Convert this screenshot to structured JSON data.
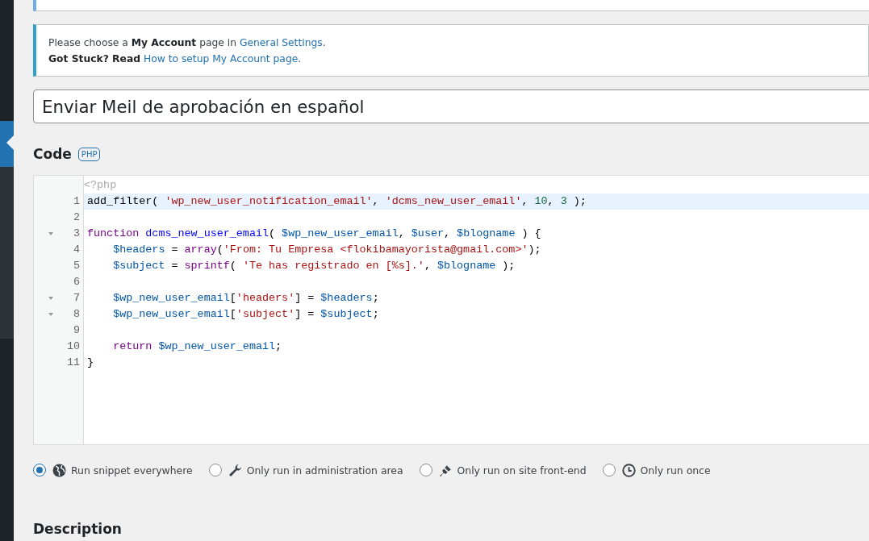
{
  "notice": {
    "lines": [
      {
        "before": "Please choose a **My Account** page in ",
        "link": "General Settings",
        "after": "."
      },
      {
        "before": "**Got Stuck? Read** ",
        "link": "How to setup My Account page",
        "after": "."
      }
    ]
  },
  "snippet_title": {
    "value": "Enviar Meil de aprobación en español"
  },
  "code_section": {
    "heading": "Code",
    "badge": "PHP"
  },
  "editor": {
    "opening_tag": "<?php",
    "lines": [
      {
        "number": "1",
        "foldable": false,
        "active": true,
        "tokens": [
          {
            "kind": "plain",
            "text": "add_filter( "
          },
          {
            "kind": "string",
            "text": "'wp_new_user_notification_email'"
          },
          {
            "kind": "plain",
            "text": ", "
          },
          {
            "kind": "string",
            "text": "'dcms_new_user_email'"
          },
          {
            "kind": "plain",
            "text": ", "
          },
          {
            "kind": "number",
            "text": "10"
          },
          {
            "kind": "plain",
            "text": ", "
          },
          {
            "kind": "number",
            "text": "3"
          },
          {
            "kind": "plain",
            "text": " );"
          }
        ]
      },
      {
        "number": "2",
        "foldable": false,
        "active": false
      },
      {
        "number": "3",
        "foldable": true,
        "active": false,
        "tokens": [
          {
            "kind": "keyword",
            "text": "function "
          },
          {
            "kind": "def",
            "text": "dcms_new_user_email"
          },
          {
            "kind": "plain",
            "text": "( "
          },
          {
            "kind": "variable",
            "text": "$wp_new_user_email"
          },
          {
            "kind": "plain",
            "text": ", "
          },
          {
            "kind": "variable",
            "text": "$user"
          },
          {
            "kind": "plain",
            "text": ", "
          },
          {
            "kind": "variable",
            "text": "$blogname"
          },
          {
            "kind": "plain",
            "text": " ) {"
          }
        ]
      },
      {
        "number": "4",
        "foldable": false,
        "active": false,
        "tokens": [
          {
            "kind": "variable",
            "text": "    $headers"
          },
          {
            "kind": "plain",
            "text": " = "
          },
          {
            "kind": "keyword",
            "text": "array"
          },
          {
            "kind": "plain",
            "text": "("
          },
          {
            "kind": "string",
            "text": "'From: Tu Empresa <flokibamayorista@gmail.com>'"
          },
          {
            "kind": "plain",
            "text": ");"
          }
        ]
      },
      {
        "number": "5",
        "foldable": false,
        "active": false,
        "tokens": [
          {
            "kind": "variable",
            "text": "    $subject"
          },
          {
            "kind": "plain",
            "text": " = "
          },
          {
            "kind": "keyword",
            "text": "sprintf"
          },
          {
            "kind": "plain",
            "text": "( "
          },
          {
            "kind": "string",
            "text": "'Te has registrado en [%s].'"
          },
          {
            "kind": "plain",
            "text": ", "
          },
          {
            "kind": "variable",
            "text": "$blogname"
          },
          {
            "kind": "plain",
            "text": " );"
          }
        ]
      },
      {
        "number": "6",
        "foldable": false,
        "active": false
      },
      {
        "number": "7",
        "foldable": true,
        "active": false,
        "tokens": [
          {
            "kind": "variable",
            "text": "    $wp_new_user_email"
          },
          {
            "kind": "plain",
            "text": "["
          },
          {
            "kind": "string",
            "text": "'headers'"
          },
          {
            "kind": "plain",
            "text": "] = "
          },
          {
            "kind": "variable",
            "text": "$headers"
          },
          {
            "kind": "plain",
            "text": ";"
          }
        ]
      },
      {
        "number": "8",
        "foldable": true,
        "active": false,
        "tokens": [
          {
            "kind": "variable",
            "text": "    $wp_new_user_email"
          },
          {
            "kind": "plain",
            "text": "["
          },
          {
            "kind": "string",
            "text": "'subject'"
          },
          {
            "kind": "plain",
            "text": "] = "
          },
          {
            "kind": "variable",
            "text": "$subject"
          },
          {
            "kind": "plain",
            "text": ";"
          }
        ]
      },
      {
        "number": "9",
        "foldable": false,
        "active": false
      },
      {
        "number": "10",
        "foldable": false,
        "active": false,
        "tokens": [
          {
            "kind": "keyword",
            "text": "    return "
          },
          {
            "kind": "variable",
            "text": "$wp_new_user_email"
          },
          {
            "kind": "plain",
            "text": ";"
          }
        ]
      },
      {
        "number": "11",
        "foldable": false,
        "active": false,
        "tokens": [
          {
            "kind": "plain",
            "text": "}"
          }
        ]
      }
    ]
  },
  "run_options": [
    {
      "kind": "globe",
      "label": "Run snippet everywhere",
      "selected": true
    },
    {
      "kind": "wrench",
      "label": "Only run in administration area",
      "selected": false
    },
    {
      "kind": "brush",
      "label": "Only run on site front-end",
      "selected": false
    },
    {
      "kind": "clock",
      "label": "Only run once",
      "selected": false
    }
  ],
  "description_section": {
    "heading": "Description"
  }
}
